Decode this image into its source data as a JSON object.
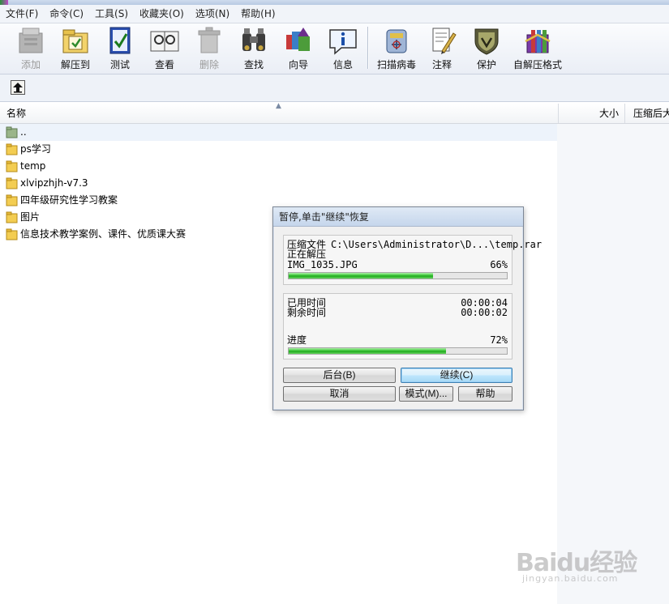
{
  "menu": [
    "文件(F)",
    "命令(C)",
    "工具(S)",
    "收藏夹(O)",
    "选项(N)",
    "帮助(H)"
  ],
  "toolbar": {
    "add": "添加",
    "extract_to": "解压到",
    "test": "测试",
    "view": "查看",
    "delete": "删除",
    "find": "查找",
    "wizard": "向导",
    "info": "信息",
    "virus_scan": "扫描病毒",
    "comment": "注释",
    "protect": "保护",
    "sfx": "自解压格式"
  },
  "columns": {
    "name": "名称",
    "size": "大小",
    "packed": "压缩后大"
  },
  "files": [
    {
      "name": "..",
      "type": "up"
    },
    {
      "name": "ps学习",
      "type": "folder"
    },
    {
      "name": "temp",
      "type": "folder"
    },
    {
      "name": "xlvipzhjh-v7.3",
      "type": "folder"
    },
    {
      "name": "四年级研究性学习教案",
      "type": "folder"
    },
    {
      "name": "图片",
      "type": "folder"
    },
    {
      "name": "信息技术教学案例、课件、优质课大赛",
      "type": "folder"
    }
  ],
  "dialog": {
    "title": "暂停,单击\"继续\"恢复",
    "compress_label": "压缩文件",
    "archive_path": "C:\\Users\\Administrator\\D...\\temp.rar",
    "status_label": "正在解压",
    "current_file": "IMG_1035.JPG",
    "file_percent_text": "66%",
    "file_progress": 0.66,
    "elapsed_label": "已用时间",
    "elapsed": "00:00:04",
    "remaining_label": "剩余时间",
    "remaining": "00:00:02",
    "progress_label": "进度",
    "total_percent_text": "72%",
    "total_progress": 0.72,
    "buttons": {
      "background": "后台(B)",
      "continue": "继续(C)",
      "cancel": "取消",
      "mode": "模式(M)...",
      "help": "帮助"
    }
  },
  "watermark": {
    "brand": "Baidu经验",
    "url": "jingyan.baidu.com"
  }
}
